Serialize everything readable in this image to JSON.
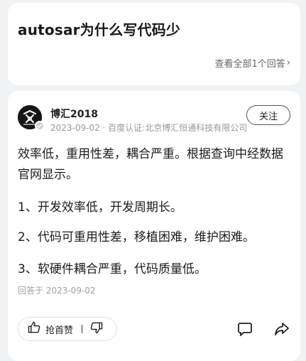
{
  "question": {
    "title": "autosar为什么写代码少",
    "view_all": "查看全部1个回答",
    "chevron": "›"
  },
  "answer": {
    "author": {
      "name": "博汇2018",
      "meta": "2023-09-02 · 百度认证:北京博汇恒通科技有限公司",
      "avatar_icon": "avatar-logo-icon"
    },
    "follow_label": "关注",
    "paragraphs": [
      "效率低，重用性差，耦合严重。根据查询中经数据官网显示。",
      "1、开发效率低，开发周期长。",
      "2、代码可重用性差，移植困难，维护困难。",
      "3、软硬件耦合严重，代码质量低。"
    ],
    "answered_at": "回答于 2023-09-02",
    "actions": {
      "upvote_label": "抢首赞",
      "upvote_icon": "thumbs-up-icon",
      "downvote_icon": "thumbs-down-icon",
      "comment_icon": "comment-icon",
      "share_icon": "share-icon"
    }
  },
  "colors": {
    "background": "#f1f2f4",
    "card": "#ffffff",
    "muted_text": "#999999"
  }
}
